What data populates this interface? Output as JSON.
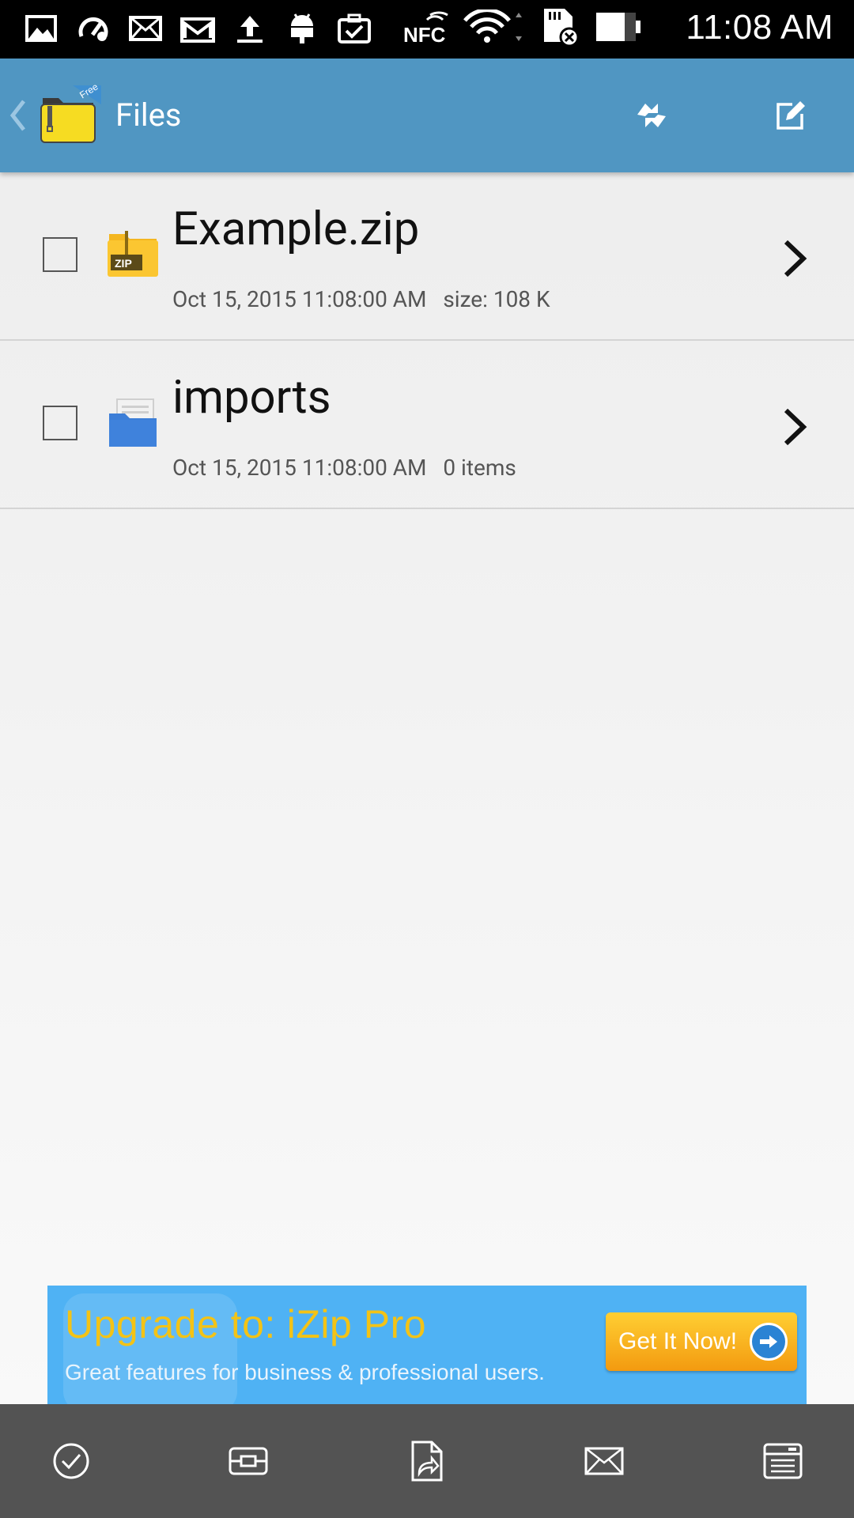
{
  "status_bar": {
    "time": "11:08 AM",
    "left_icons": [
      "gallery-icon",
      "speed-test-icon",
      "email-icon",
      "gmail-icon",
      "upload-icon",
      "android-icon",
      "clipboard-check-icon"
    ],
    "right_icons": [
      "nfc-icon",
      "wifi-icon",
      "sd-card-error-icon",
      "battery-icon"
    ],
    "nfc_label": "NFC"
  },
  "app_bar": {
    "title": "Files",
    "logo_badge": "Free",
    "color": "#5096c2"
  },
  "files": [
    {
      "name": "Example.zip",
      "date": "Oct 15, 2015 11:08:00 AM",
      "detail": "size: 108 K",
      "type": "zip",
      "icon_label": "ZIP",
      "checked": false
    },
    {
      "name": "imports",
      "date": "Oct 15, 2015 11:08:00 AM",
      "detail": "0 items",
      "type": "folder",
      "checked": false
    }
  ],
  "ad": {
    "title_prefix": "Upgrade to:",
    "title_product": "iZip Pro",
    "subtitle": "Great features for business & professional users.",
    "cta_label": "Get It Now!"
  },
  "toolbar": {
    "items": [
      "select-all-icon",
      "extract-icon",
      "share-icon",
      "email-icon",
      "archive-icon"
    ],
    "color": "#535353"
  }
}
